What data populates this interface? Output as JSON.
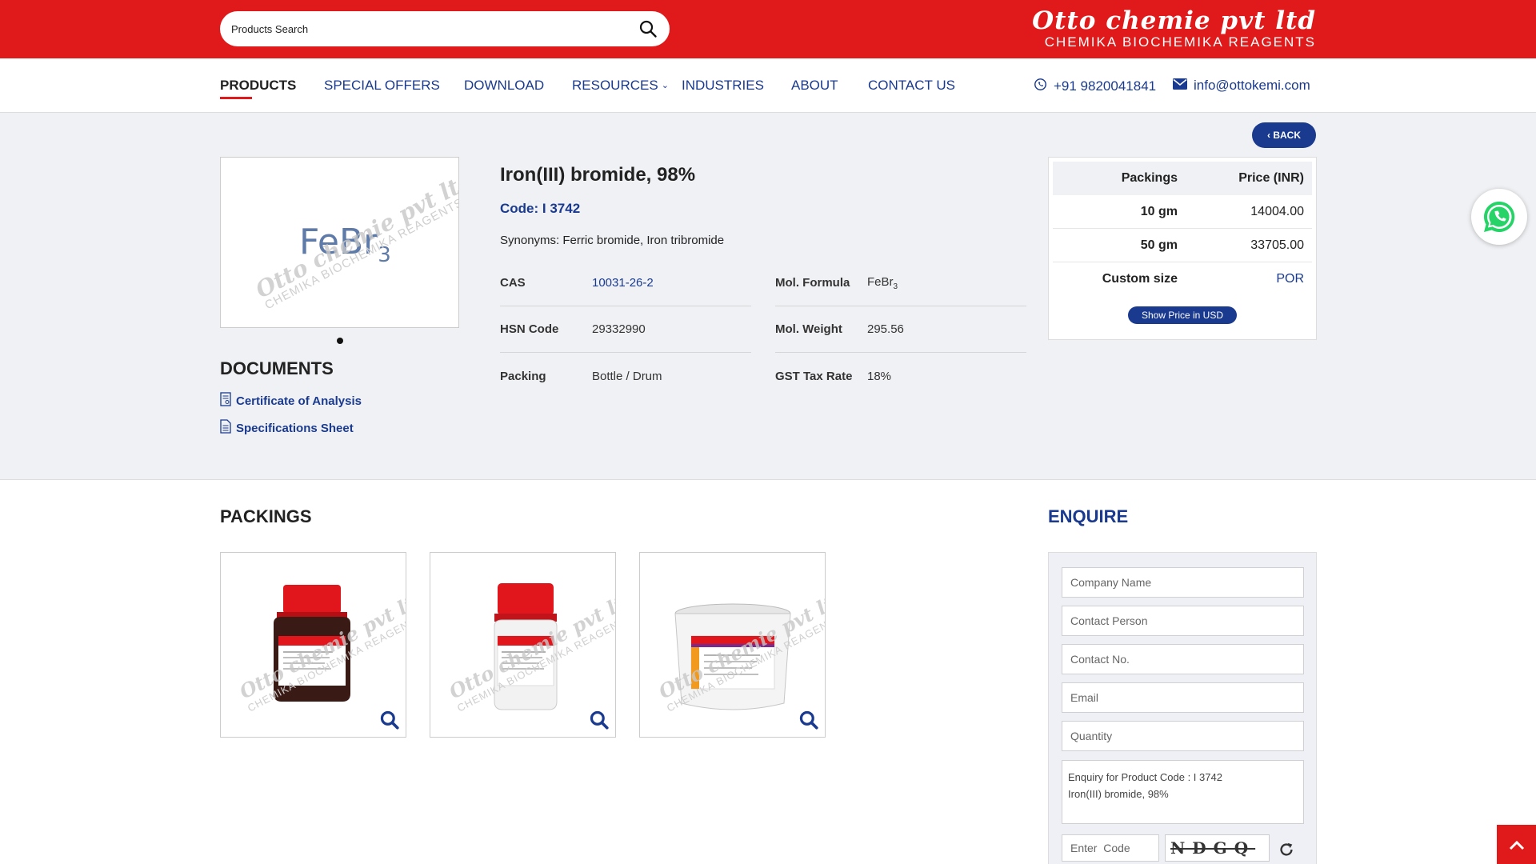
{
  "search": {
    "placeholder": "Products Search"
  },
  "brand": {
    "name": "Otto chemie pvt ltd",
    "tagline": "CHEMIKA BIOCHEMIKA  REAGENTS"
  },
  "nav": {
    "items": [
      "PRODUCTS",
      "SPECIAL OFFERS",
      "DOWNLOAD",
      "RESOURCES",
      "INDUSTRIES",
      "ABOUT",
      "CONTACT US"
    ],
    "phone": "+91 9820041841",
    "email": "info@ottokemi.com"
  },
  "back_label": "BACK",
  "product": {
    "image_formula": "FeBr",
    "image_subscript": "3",
    "watermark": "Otto chemie pvt ltd",
    "watermark_tag": "CHEMIKA BIOCHEMIKA REAGENTS",
    "title": "Iron(III) bromide, 98%",
    "code": "Code: I 3742",
    "synonyms": "Synonyms: Ferric bromide, Iron tribromide",
    "props": [
      {
        "key": "CAS",
        "value": "10031-26-2"
      },
      {
        "key": "HSN Code",
        "value": "29332990"
      },
      {
        "key": "Packing",
        "value": "Bottle / Drum"
      },
      {
        "key": "Mol. Formula",
        "value": "FeBr",
        "sub": "3"
      },
      {
        "key": "Mol. Weight",
        "value": "295.56"
      },
      {
        "key": "GST Tax Rate",
        "value": "18%"
      }
    ]
  },
  "documents": {
    "title": "DOCUMENTS",
    "links": [
      "Certificate of Analysis",
      "Specifications Sheet"
    ]
  },
  "prices": {
    "headers": [
      "Packings",
      "Price (INR)"
    ],
    "rows": [
      {
        "pack": "10 gm",
        "price": "14004.00"
      },
      {
        "pack": "50 gm",
        "price": "33705.00"
      },
      {
        "pack": "Custom size",
        "price": "POR"
      }
    ],
    "usd_button": "Show Price in USD"
  },
  "packings": {
    "title": "PACKINGS",
    "bottle_brand": "ottokemi"
  },
  "enquire": {
    "title": "ENQUIRE",
    "placeholders": [
      "Company Name",
      "Contact Person",
      "Contact No.",
      "Email",
      "Quantity"
    ],
    "message_line1": "Enquiry for Product Code : I 3742",
    "message_line2": "Iron(III) bromide, 98%",
    "captcha_placeholder": "Enter  Code",
    "captcha_text": "NDGQ"
  },
  "colors": {
    "brand_red": "#e01a1a",
    "primary_blue": "#1a3a8f",
    "whatsapp_green": "#25d366"
  }
}
